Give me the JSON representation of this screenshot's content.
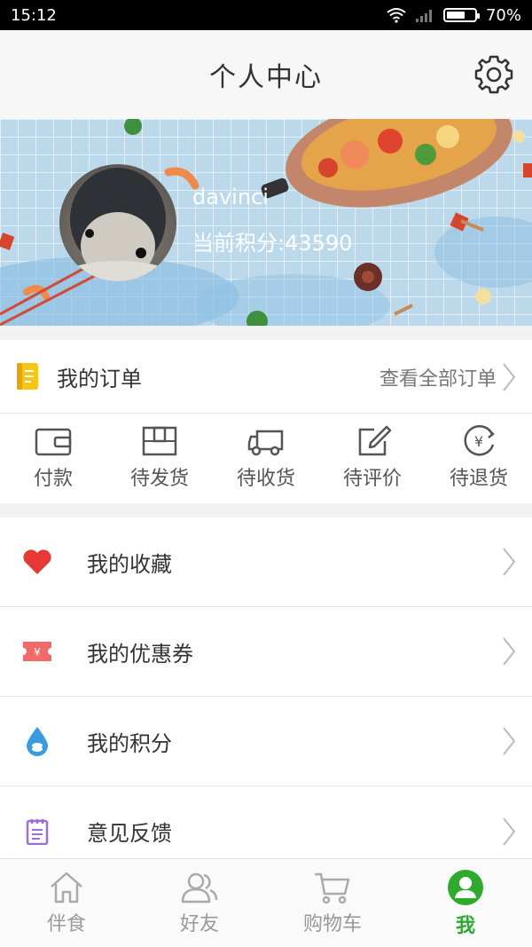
{
  "status_bar": {
    "time": "15:12",
    "battery_percent": "70%",
    "battery_level": 0.7,
    "icons": [
      "wifi-icon",
      "signal-icon",
      "battery-icon"
    ]
  },
  "header": {
    "title": "个人中心",
    "settings_icon": "gear-icon"
  },
  "profile": {
    "username": "davinci",
    "points_text": "当前积分:43590"
  },
  "orders": {
    "title": "我的订单",
    "view_all": "查看全部订单",
    "statuses": [
      {
        "label": "付款",
        "icon": "wallet-icon"
      },
      {
        "label": "待发货",
        "icon": "package-icon"
      },
      {
        "label": "待收货",
        "icon": "truck-icon"
      },
      {
        "label": "待评价",
        "icon": "edit-icon"
      },
      {
        "label": "待退货",
        "icon": "refund-icon"
      }
    ]
  },
  "menu": {
    "items": [
      {
        "label": "我的收藏",
        "icon": "heart-icon",
        "color": "#e53935"
      },
      {
        "label": "我的优惠券",
        "icon": "coupon-icon",
        "color": "#f06a6a"
      },
      {
        "label": "我的积分",
        "icon": "points-drop-icon",
        "color": "#3a9be0"
      },
      {
        "label": "意见反馈",
        "icon": "feedback-icon",
        "color": "#9b6fd6"
      }
    ]
  },
  "bottom_nav": {
    "items": [
      {
        "label": "伴食",
        "icon": "home-icon"
      },
      {
        "label": "好友",
        "icon": "friends-icon"
      },
      {
        "label": "购物车",
        "icon": "cart-icon"
      },
      {
        "label": "我",
        "icon": "profile-icon",
        "active": true
      }
    ],
    "active_color": "#2eaa2e",
    "inactive_color": "#999999"
  }
}
